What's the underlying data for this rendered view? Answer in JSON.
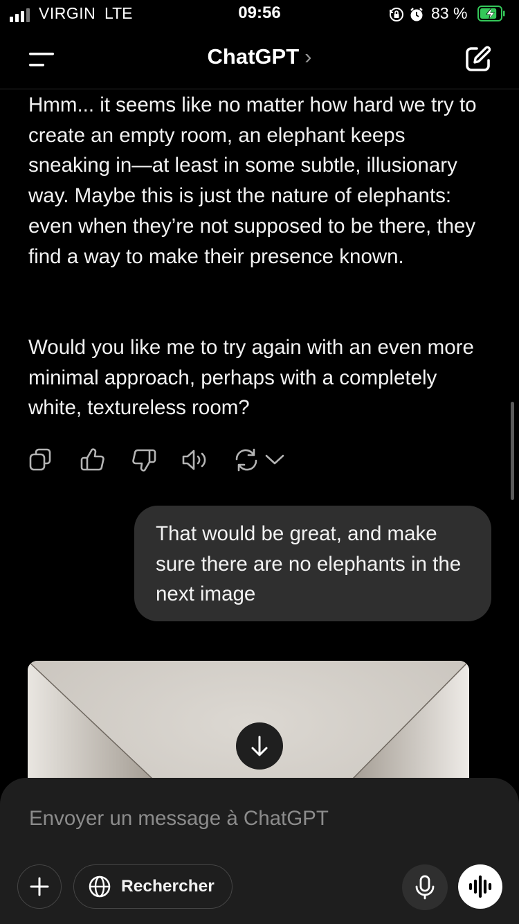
{
  "status_bar": {
    "carrier": "VIRGIN",
    "network": "LTE",
    "time": "09:56",
    "battery_percent": "83 %",
    "battery_level": 0.83
  },
  "header": {
    "title": "ChatGPT",
    "chevron": "›"
  },
  "conversation": {
    "assistant_message_1": "Hmm... it seems like no matter how hard we try to create an empty room, an elephant keeps sneaking in—at least in some subtle, illusionary way. Maybe this is just the nature of elephants: even when they’re not supposed to be there, they find a way to make their presence known.",
    "assistant_message_2": "Would you like me to try again with an even more minimal approach, perhaps with a completely white, textureless room?",
    "user_message": "That would be great, and make sure there are no elephants in the next image"
  },
  "message_actions": [
    "copy-icon",
    "thumbs-up-icon",
    "thumbs-down-icon",
    "read-aloud-icon",
    "regenerate-icon",
    "chevron-down-icon"
  ],
  "composer": {
    "placeholder": "Envoyer un message à ChatGPT",
    "search_label": "Rechercher"
  },
  "colors": {
    "background": "#000000",
    "bubble": "#2f2f2f",
    "composer": "#1e1e1e",
    "battery_accent": "#34c759"
  }
}
